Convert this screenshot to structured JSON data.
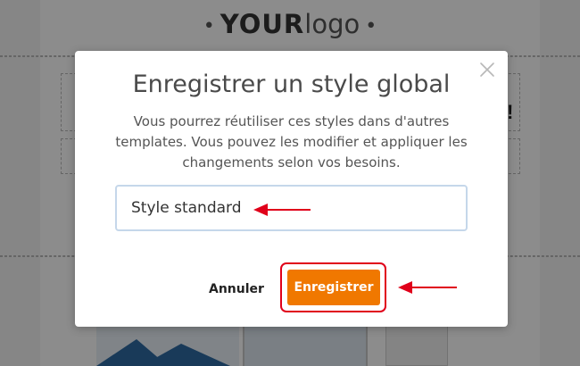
{
  "background": {
    "logo_bold": "YOUR",
    "logo_light": "logo",
    "excl": "!"
  },
  "modal": {
    "title": "Enregistrer un style global",
    "description": "Vous pourrez réutiliser ces styles dans d'autres templates. Vous pouvez les modifier et appliquer les changements selon vos besoins.",
    "input_value": "Style standard",
    "cancel_label": "Annuler",
    "save_label": "Enregistrer",
    "close_icon": "close-icon"
  },
  "colors": {
    "accent": "#f07800",
    "highlight": "#e0001a",
    "input_border": "#c5d7ea"
  }
}
